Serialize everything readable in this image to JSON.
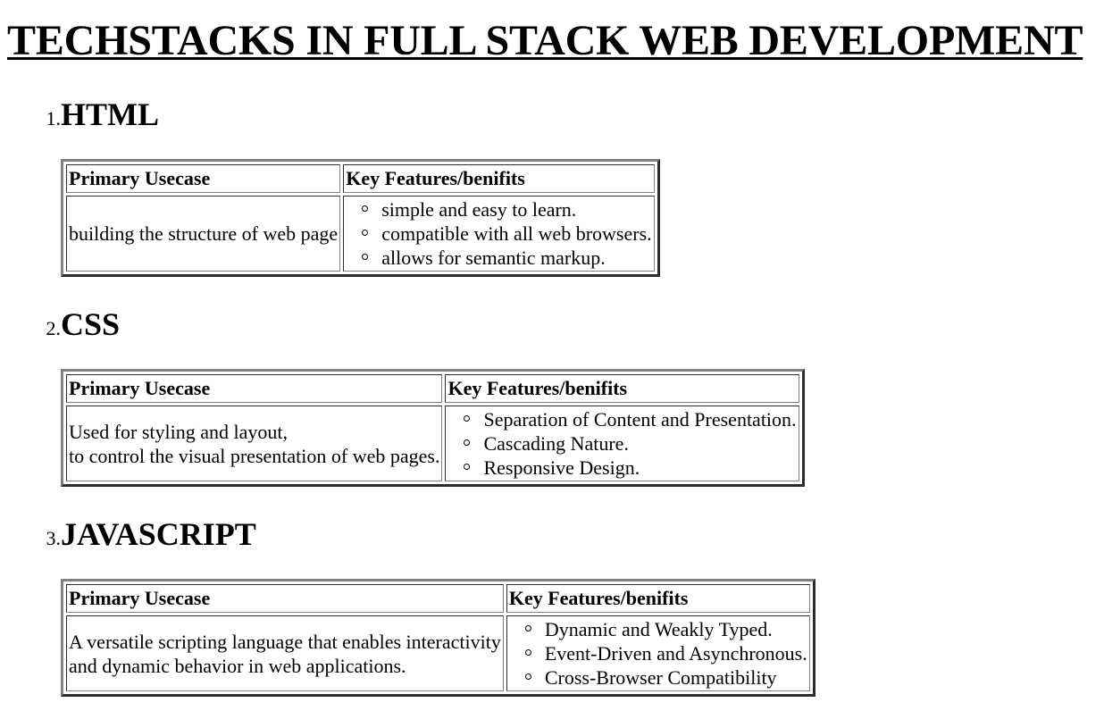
{
  "page": {
    "title": "TECHSTACKS IN FULL STACK WEB DEVELOPMENT"
  },
  "headers": {
    "usecase": "Primary Usecase",
    "features": "Key Features/benifits"
  },
  "sections": [
    {
      "number": "1.",
      "title": "HTML",
      "usecase_lines": [
        "building the structure of web page"
      ],
      "features": [
        "simple and easy to learn.",
        "compatible with all web browsers.",
        "allows for semantic markup."
      ]
    },
    {
      "number": "2.",
      "title": "CSS",
      "usecase_lines": [
        "Used for styling and layout,",
        "to control the visual presentation of web pages."
      ],
      "features": [
        "Separation of Content and Presentation.",
        "Cascading Nature.",
        "Responsive Design."
      ]
    },
    {
      "number": "3.",
      "title": "JAVASCRIPT",
      "usecase_lines": [
        "A versatile scripting language that enables interactivity",
        "and dynamic behavior in web applications."
      ],
      "features": [
        "Dynamic and Weakly Typed.",
        "Event-Driven and Asynchronous.",
        "Cross-Browser Compatibility"
      ]
    }
  ]
}
